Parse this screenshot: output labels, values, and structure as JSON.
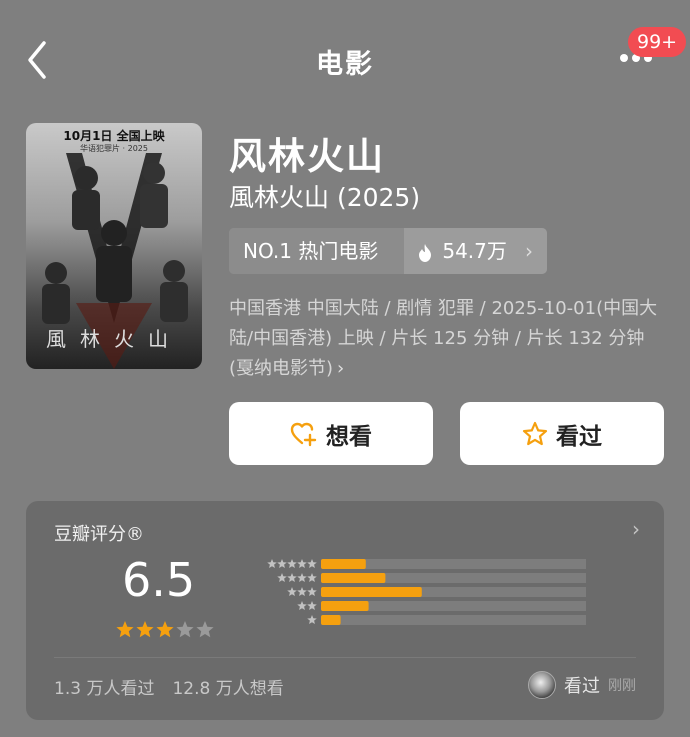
{
  "nav": {
    "title": "电影",
    "badge": "99+"
  },
  "poster": {
    "top_text": "10月1日 全国上映",
    "sub_text": "华语犯罪片 ·  2025",
    "title_text": "風林火山"
  },
  "movie": {
    "title": "风林火山",
    "subtitle": "風林火山 (2025)"
  },
  "rank": {
    "label": "NO.1 热门电影",
    "heat": "54.7万"
  },
  "info": {
    "text": "中国香港 中国大陆 / 剧情 犯罪 / 2025-10-01(中国大陆/中国香港) 上映 / 片长 125 分钟 / 片长 132 分钟 (戛纳电影节)"
  },
  "actions": {
    "want_label": "想看",
    "seen_label": "看过"
  },
  "rating": {
    "title": "豆瓣评分®",
    "score": "6.5",
    "star_fill": 3,
    "distribution": [
      {
        "stars": 5,
        "fraction": 0.16
      },
      {
        "stars": 4,
        "fraction": 0.23
      },
      {
        "stars": 3,
        "fraction": 0.36
      },
      {
        "stars": 2,
        "fraction": 0.17
      },
      {
        "stars": 1,
        "fraction": 0.07
      }
    ],
    "seen_count": "1.3 万人看过",
    "want_count": "12.8 万人想看",
    "friend_action": "看过",
    "friend_time": "刚刚"
  },
  "colors": {
    "bar": "#f5a00f",
    "star": "#f5a00f",
    "badge": "#f24c52"
  },
  "icons": [
    "back-arrow-icon",
    "more-dots-icon",
    "fire-icon",
    "chevron-right-icon",
    "heart-plus-icon",
    "star-icon"
  ]
}
